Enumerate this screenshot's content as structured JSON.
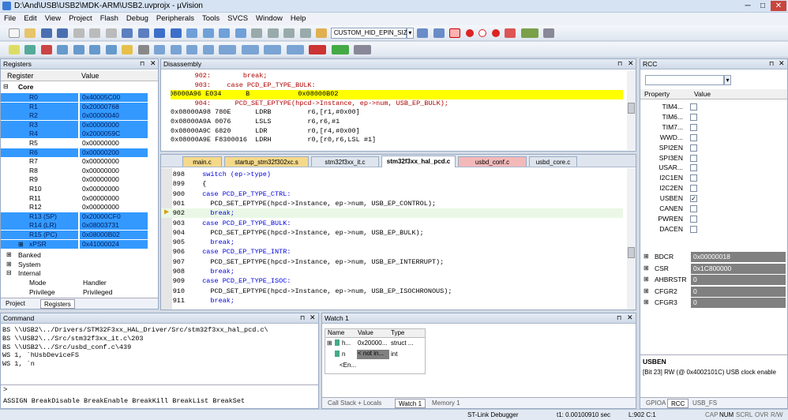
{
  "window": {
    "title": "D:\\And\\USB\\USB2\\MDK-ARM\\USB2.uvprojx - µVision",
    "min": "─",
    "max": "□",
    "close": "✕"
  },
  "menu": [
    "File",
    "Edit",
    "View",
    "Project",
    "Flash",
    "Debug",
    "Peripherals",
    "Tools",
    "SVCS",
    "Window",
    "Help"
  ],
  "toolbar": {
    "target_select": "CUSTOM_HID_EPIN_SIZE"
  },
  "registers": {
    "title": "Registers",
    "col_register": "Register",
    "col_value": "Value",
    "core_label": "Core",
    "rows": [
      {
        "n": "R0",
        "v": "0x40005C00",
        "hl": true
      },
      {
        "n": "R1",
        "v": "0x20000768",
        "hl": true
      },
      {
        "n": "R2",
        "v": "0x00000040",
        "hl": true
      },
      {
        "n": "R3",
        "v": "0x00000000",
        "hl": true
      },
      {
        "n": "R4",
        "v": "0x2000059C",
        "hl": true
      },
      {
        "n": "R5",
        "v": "0x00000000",
        "hl": false
      },
      {
        "n": "R6",
        "v": "0x00000200",
        "hl": true
      },
      {
        "n": "R7",
        "v": "0x00000000",
        "hl": false
      },
      {
        "n": "R8",
        "v": "0x00000000",
        "hl": false
      },
      {
        "n": "R9",
        "v": "0x00000000",
        "hl": false
      },
      {
        "n": "R10",
        "v": "0x00000000",
        "hl": false
      },
      {
        "n": "R11",
        "v": "0x00000000",
        "hl": false
      },
      {
        "n": "R12",
        "v": "0x00000000",
        "hl": false
      },
      {
        "n": "R13 (SP)",
        "v": "0x20000CF0",
        "hl": true
      },
      {
        "n": "R14 (LR)",
        "v": "0x08003731",
        "hl": true
      },
      {
        "n": "R15 (PC)",
        "v": "0x08000B02",
        "hl": true
      },
      {
        "n": "xPSR",
        "v": "0x41000024",
        "hl": true
      }
    ],
    "groups": [
      "Banked",
      "System",
      "Internal"
    ],
    "internal_rows": [
      {
        "n": "Mode",
        "v": "Handler"
      },
      {
        "n": "Privilege",
        "v": "Privileged"
      }
    ],
    "tab_project": "Project",
    "tab_registers": "Registers"
  },
  "disassembly": {
    "title": "Disassembly",
    "lines": [
      {
        "t": "      902:        break;",
        "style": "src"
      },
      {
        "t": "      903:    case PCD_EP_TYPE_BULK:",
        "style": "src"
      },
      {
        "t": "0x08000A96 E034      B            0x08000B02",
        "style": "cur"
      },
      {
        "t": "      904:      PCD_SET_EPTYPE(hpcd->Instance, ep->num, USB_EP_BULK);",
        "style": "src"
      },
      {
        "t": "0x08000A98 780E      LDRB         r6,[r1,#0x00]",
        "style": "asm"
      },
      {
        "t": "0x08000A9A 0076      LSLS         r6,r6,#1",
        "style": "asm"
      },
      {
        "t": "0x08000A9C 6820      LDR          r0,[r4,#0x00]",
        "style": "asm"
      },
      {
        "t": "0x08000A9E F8300016  LDRH         r0,[r0,r6,LSL #1]",
        "style": "asm"
      }
    ]
  },
  "editor": {
    "tabs": [
      "main.c",
      "startup_stm32f302xc.s",
      "stm32f3xx_it.c",
      "stm32f3xx_hal_pcd.c",
      "usbd_conf.c",
      "usbd_core.c"
    ],
    "active_tab": 3,
    "lines": [
      {
        "n": "898",
        "t": "  switch (ep->type)"
      },
      {
        "n": "899",
        "t": "  {"
      },
      {
        "n": "900",
        "t": "  case PCD_EP_TYPE_CTRL:"
      },
      {
        "n": "901",
        "t": "    PCD_SET_EPTYPE(hpcd->Instance, ep->num, USB_EP_CONTROL);"
      },
      {
        "n": "902",
        "t": "    break;"
      },
      {
        "n": "903",
        "t": "  case PCD_EP_TYPE_BULK:"
      },
      {
        "n": "904",
        "t": "    PCD_SET_EPTYPE(hpcd->Instance, ep->num, USB_EP_BULK);"
      },
      {
        "n": "905",
        "t": "    break;"
      },
      {
        "n": "906",
        "t": "  case PCD_EP_TYPE_INTR:"
      },
      {
        "n": "907",
        "t": "    PCD_SET_EPTYPE(hpcd->Instance, ep->num, USB_EP_INTERRUPT);"
      },
      {
        "n": "908",
        "t": "    break;"
      },
      {
        "n": "909",
        "t": "  case PCD_EP_TYPE_ISOC:"
      },
      {
        "n": "910",
        "t": "    PCD_SET_EPTYPE(hpcd->Instance, ep->num, USB_EP_ISOCHRONOUS);"
      },
      {
        "n": "911",
        "t": "    break;"
      }
    ]
  },
  "command": {
    "title": "Command",
    "lines": [
      "BS \\\\USB2\\../Drivers/STM32F3xx_HAL_Driver/Src/stm32f3xx_hal_pcd.c\\",
      "BS \\\\USB2\\../Src/stm32f3xx_it.c\\203",
      "BS \\\\USB2\\../Src/usbd_conf.c\\439",
      "WS 1, `hUsbDeviceFS",
      "WS 1, `n"
    ],
    "prompt": ">",
    "help": "ASSIGN BreakDisable BreakEnable BreakKill BreakList BreakSet"
  },
  "watch": {
    "title": "Watch 1",
    "cols": [
      "Name",
      "Value",
      "Type"
    ],
    "rows": [
      {
        "n": "h...",
        "v": "0x20000...",
        "t": "struct ..."
      },
      {
        "n": "n",
        "v": "< not in...",
        "t": "int"
      },
      {
        "n": "<En...",
        "v": "",
        "t": ""
      }
    ],
    "tabs": [
      "Call Stack + Locals",
      "Watch 1",
      "Memory 1"
    ]
  },
  "rcc": {
    "title": "RCC",
    "col_property": "Property",
    "col_value": "Value",
    "bits": [
      {
        "n": "TIM4...",
        "c": false
      },
      {
        "n": "TIM6...",
        "c": false
      },
      {
        "n": "TIM7...",
        "c": false
      },
      {
        "n": "WWD...",
        "c": false
      },
      {
        "n": "SPI2EN",
        "c": false
      },
      {
        "n": "SPI3EN",
        "c": false
      },
      {
        "n": "USAR...",
        "c": false
      },
      {
        "n": "I2C1EN",
        "c": false
      },
      {
        "n": "I2C2EN",
        "c": false
      },
      {
        "n": "USBEN",
        "c": true
      },
      {
        "n": "CANEN",
        "c": false
      },
      {
        "n": "PWREN",
        "c": false
      },
      {
        "n": "DACEN",
        "c": false
      }
    ],
    "check_mark": "✓",
    "regs": [
      {
        "n": "BDCR",
        "v": "0x00000018"
      },
      {
        "n": "CSR",
        "v": "0x1C800000"
      },
      {
        "n": "AHBRSTR",
        "v": "0"
      },
      {
        "n": "CFGR2",
        "v": "0"
      },
      {
        "n": "CFGR3",
        "v": "0"
      }
    ],
    "desc_title": "USBEN",
    "desc_text": "[Bit 23] RW (@ 0x4002101C) USB clock enable",
    "tabs": [
      "GPIOA",
      "RCC",
      "USB_FS"
    ]
  },
  "status": {
    "debugger": "ST-Link Debugger",
    "time": "t1: 0.00100910 sec",
    "pos": "L:902 C:1",
    "indicators": [
      "CAP",
      "NUM",
      "SCRL",
      "OVR",
      "R/W"
    ]
  }
}
